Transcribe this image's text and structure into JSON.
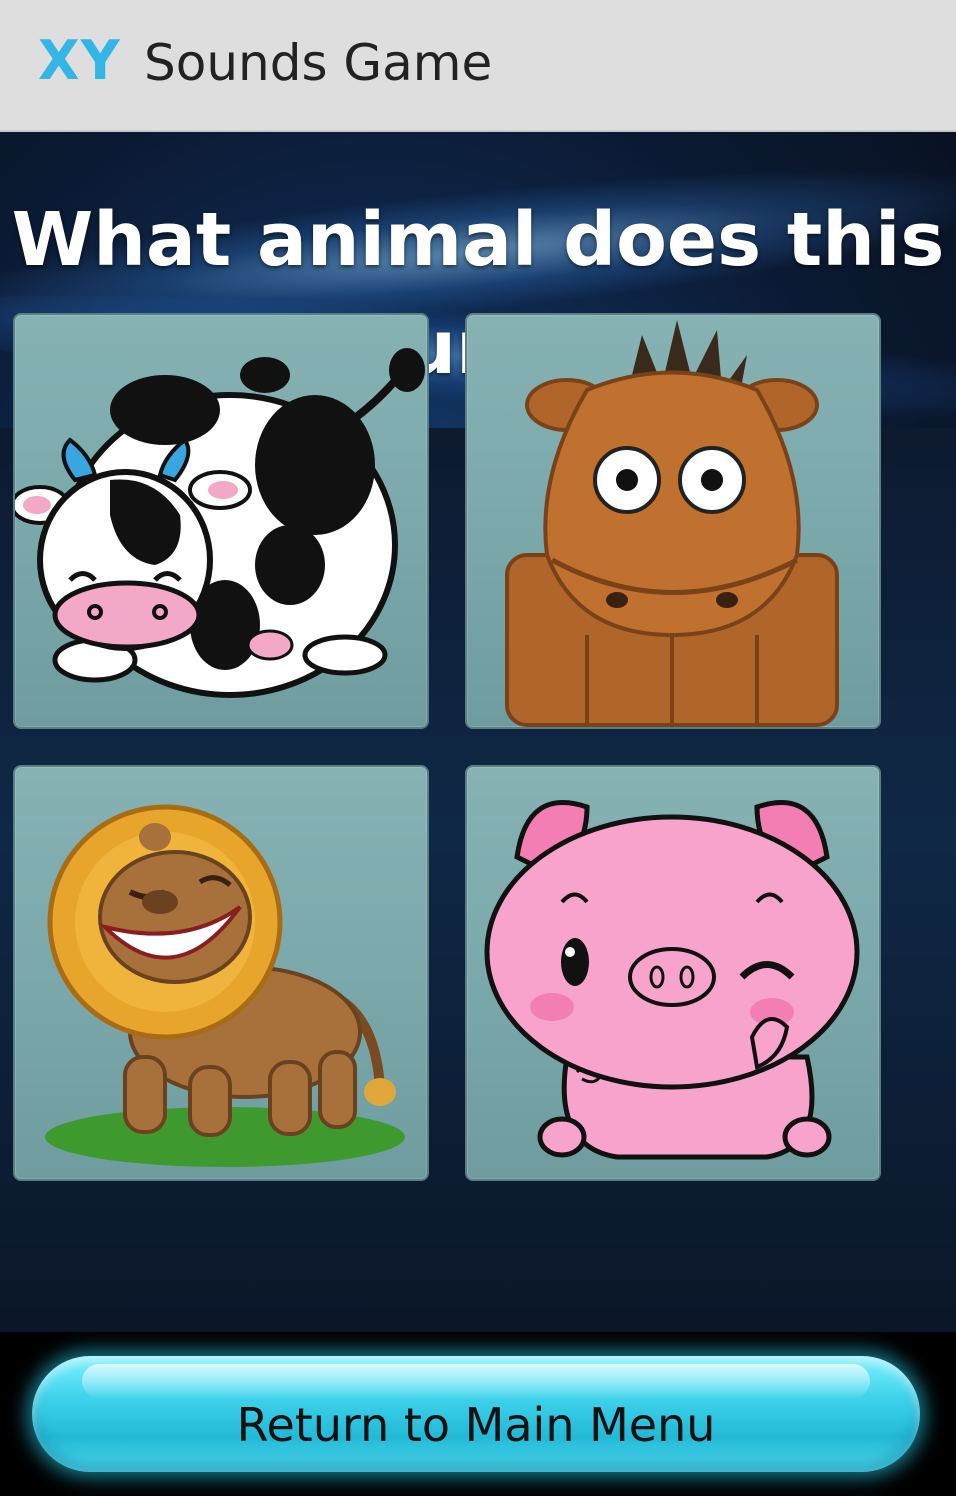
{
  "action_bar": {
    "logo_text": "XY",
    "title": "Sounds Game"
  },
  "question": {
    "text": "What animal does this sound??"
  },
  "answer_tiles": [
    {
      "animal": "cow"
    },
    {
      "animal": "horse"
    },
    {
      "animal": "lion"
    },
    {
      "animal": "pig"
    }
  ],
  "bottom": {
    "return_button_label": "Return to Main Menu"
  },
  "colors": {
    "logo_blue": "#33b5e5",
    "action_bar_bg": "#dedede",
    "tile_bg": "#7aa7a9",
    "button_cyan": "#22b9d6"
  }
}
